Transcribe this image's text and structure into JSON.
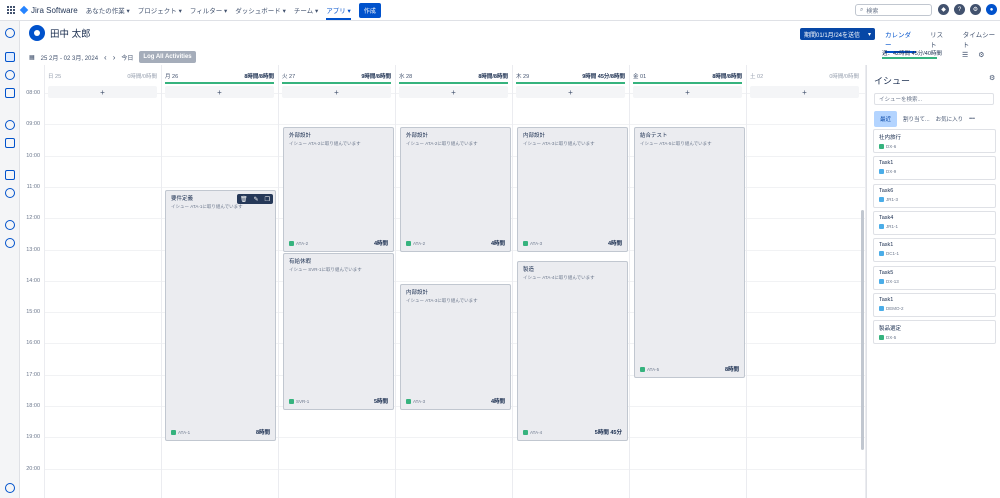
{
  "topnav": {
    "logo": "Jira Software",
    "menu": [
      "あなたの作業 ▾",
      "プロジェクト ▾",
      "フィルター ▾",
      "ダッシュボード ▾",
      "チーム ▾",
      "アプリ ▾"
    ],
    "create": "作成",
    "search_placeholder": "検索"
  },
  "user": {
    "name": "田中 太郎"
  },
  "period_button": "期間01/1月/24を送信",
  "view_tabs": [
    "カレンダー",
    "リスト",
    "タイムシート"
  ],
  "toolbar": {
    "date_range": "25 2月 - 02 3月, 2024",
    "today": "今日",
    "log_all": "Log All Activities"
  },
  "week_summary": "週：42時間 45分/40時間",
  "hours": [
    "08:00",
    "09:00",
    "10:00",
    "11:00",
    "12:00",
    "13:00",
    "14:00",
    "15:00",
    "16:00",
    "17:00",
    "18:00",
    "19:00",
    "20:00"
  ],
  "days": [
    {
      "label": "日 25",
      "hours": "0時間/0時間",
      "muted": true,
      "green": false
    },
    {
      "label": "月 26",
      "hours": "8時間/8時間",
      "muted": false,
      "green": true
    },
    {
      "label": "火 27",
      "hours": "9時間/8時間",
      "muted": false,
      "green": true
    },
    {
      "label": "水 28",
      "hours": "8時間/8時間",
      "muted": false,
      "green": true
    },
    {
      "label": "木 29",
      "hours": "9時間 45分/8時間",
      "muted": false,
      "green": true
    },
    {
      "label": "金 01",
      "hours": "8時間/8時間",
      "muted": false,
      "green": true
    },
    {
      "label": "土 02",
      "hours": "0時間/0時間",
      "muted": true,
      "green": false
    }
  ],
  "worklogs": [
    {
      "title": "要件定義",
      "sub": "イシュー ATA-1に取り組んでいます",
      "key": "ATA-1",
      "duration": "8時間"
    },
    {
      "title": "外部設計",
      "sub": "イシュー ATA-2に取り組んでいます",
      "key": "ATA-2",
      "duration": "4時間"
    },
    {
      "title": "有給休暇",
      "sub": "イシュー SVR-1に取り組んでいます",
      "key": "SVR-1",
      "duration": "5時間"
    },
    {
      "title": "外部設計",
      "sub": "イシュー ATA-2に取り組んでいます",
      "key": "ATA-2",
      "duration": "4時間"
    },
    {
      "title": "内部設計",
      "sub": "イシュー ATA-3に取り組んでいます",
      "key": "ATA-3",
      "duration": "4時間"
    },
    {
      "title": "内部設計",
      "sub": "イシュー ATA-3に取り組んでいます",
      "key": "ATA-3",
      "duration": "4時間"
    },
    {
      "title": "製造",
      "sub": "イシュー ATA-4に取り組んでいます",
      "key": "ATA-4",
      "duration": "5時間 45分"
    },
    {
      "title": "結合テスト",
      "sub": "イシュー ATA-5に取り組んでいます",
      "key": "ATA-5",
      "duration": "8時間"
    }
  ],
  "issue_panel": {
    "title": "イシュー",
    "search_placeholder": "イシューを検索...",
    "tabs": [
      "最近",
      "割り当て...",
      "お気に入り",
      "•••"
    ],
    "issues": [
      {
        "title": "社内旅行",
        "key": "DX-6",
        "color": "#36b37e"
      },
      {
        "title": "Task1",
        "key": "DX-9",
        "color": "#4bade8"
      },
      {
        "title": "Task6",
        "key": "JR1-3",
        "color": "#4bade8"
      },
      {
        "title": "Task4",
        "key": "JR1-1",
        "color": "#4bade8"
      },
      {
        "title": "Task1",
        "key": "DC1-1",
        "color": "#4bade8"
      },
      {
        "title": "Task5",
        "key": "DX-13",
        "color": "#4bade8"
      },
      {
        "title": "Task1",
        "key": "DEMO-2",
        "color": "#4bade8"
      },
      {
        "title": "製品選定",
        "key": "DX-5",
        "color": "#36b37e"
      }
    ]
  }
}
